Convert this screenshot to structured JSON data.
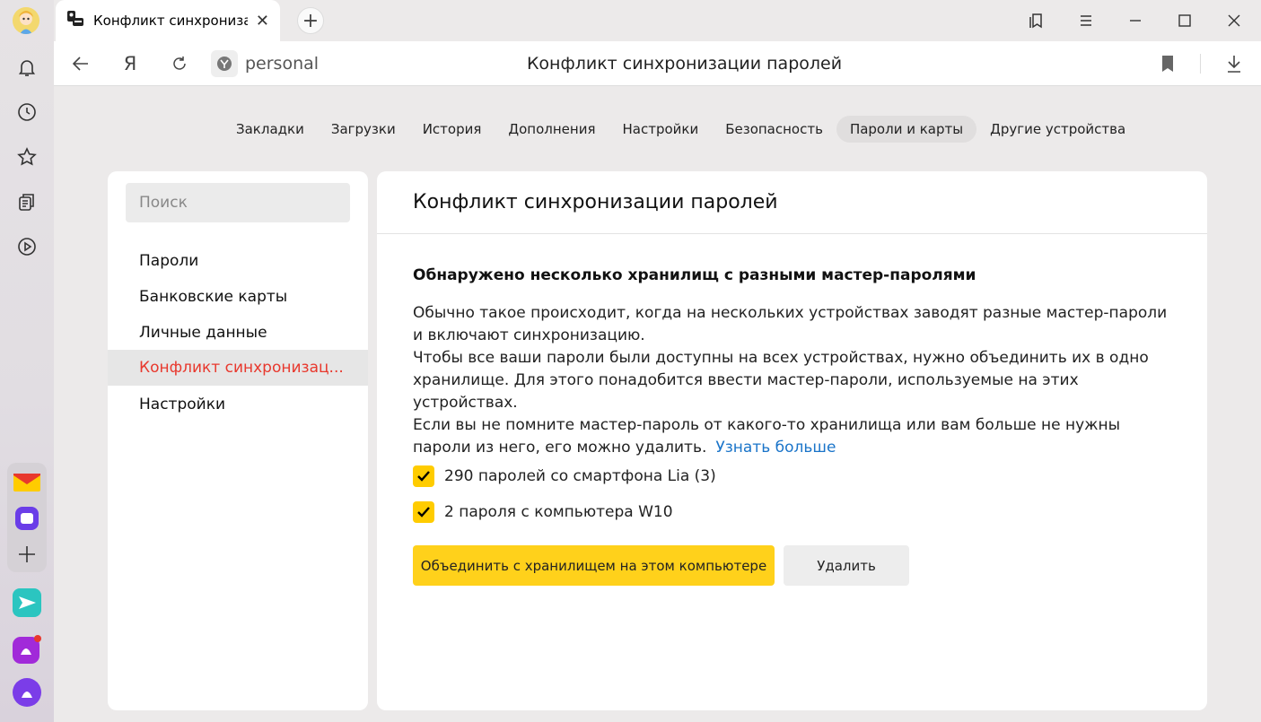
{
  "tab": {
    "title": "Конфликт синхронизац",
    "close": "✕"
  },
  "newtab": {
    "label": "+"
  },
  "address": {
    "site": "personal",
    "page_title": "Конфликт синхронизации паролей",
    "ya": "Я"
  },
  "topnav": [
    {
      "label": "Закладки"
    },
    {
      "label": "Загрузки"
    },
    {
      "label": "История"
    },
    {
      "label": "Дополнения"
    },
    {
      "label": "Настройки"
    },
    {
      "label": "Безопасность"
    },
    {
      "label": "Пароли и карты"
    },
    {
      "label": "Другие устройства"
    }
  ],
  "sidebar": {
    "search_placeholder": "Поиск",
    "items": [
      {
        "label": "Пароли"
      },
      {
        "label": "Банковские карты"
      },
      {
        "label": "Личные данные"
      },
      {
        "label": "Конфликт синхронизац..."
      },
      {
        "label": "Настройки"
      }
    ]
  },
  "content": {
    "title": "Конфликт синхронизации паролей",
    "subhead": "Обнаружено несколько хранилищ с разными мастер-паролями",
    "p1": "Обычно такое происходит, когда на нескольких устройствах заводят разные мастер-пароли и включают синхронизацию.",
    "p2": "Чтобы все ваши пароли были доступны на всех устройствах, нужно объединить их в одно хранилище. Для этого понадобится ввести мастер-пароли, используемые на этих устройствах.",
    "p3": "Если вы не помните мастер-пароль от какого-то хранилища или вам больше не нужны пароли из него, его можно удалить.",
    "learn_more": "Узнать больше",
    "checks": [
      {
        "label": "290 паролей со смартфона Lia (3)",
        "checked": true
      },
      {
        "label": "2 пароля с компьютера W10",
        "checked": true
      }
    ],
    "merge_button": "Объединить с хранилищем на этом компьютере",
    "delete_button": "Удалить"
  },
  "colors": {
    "accent_yellow": "#ffcc00",
    "active_red": "#e8382d",
    "link_blue": "#1a74c9"
  }
}
